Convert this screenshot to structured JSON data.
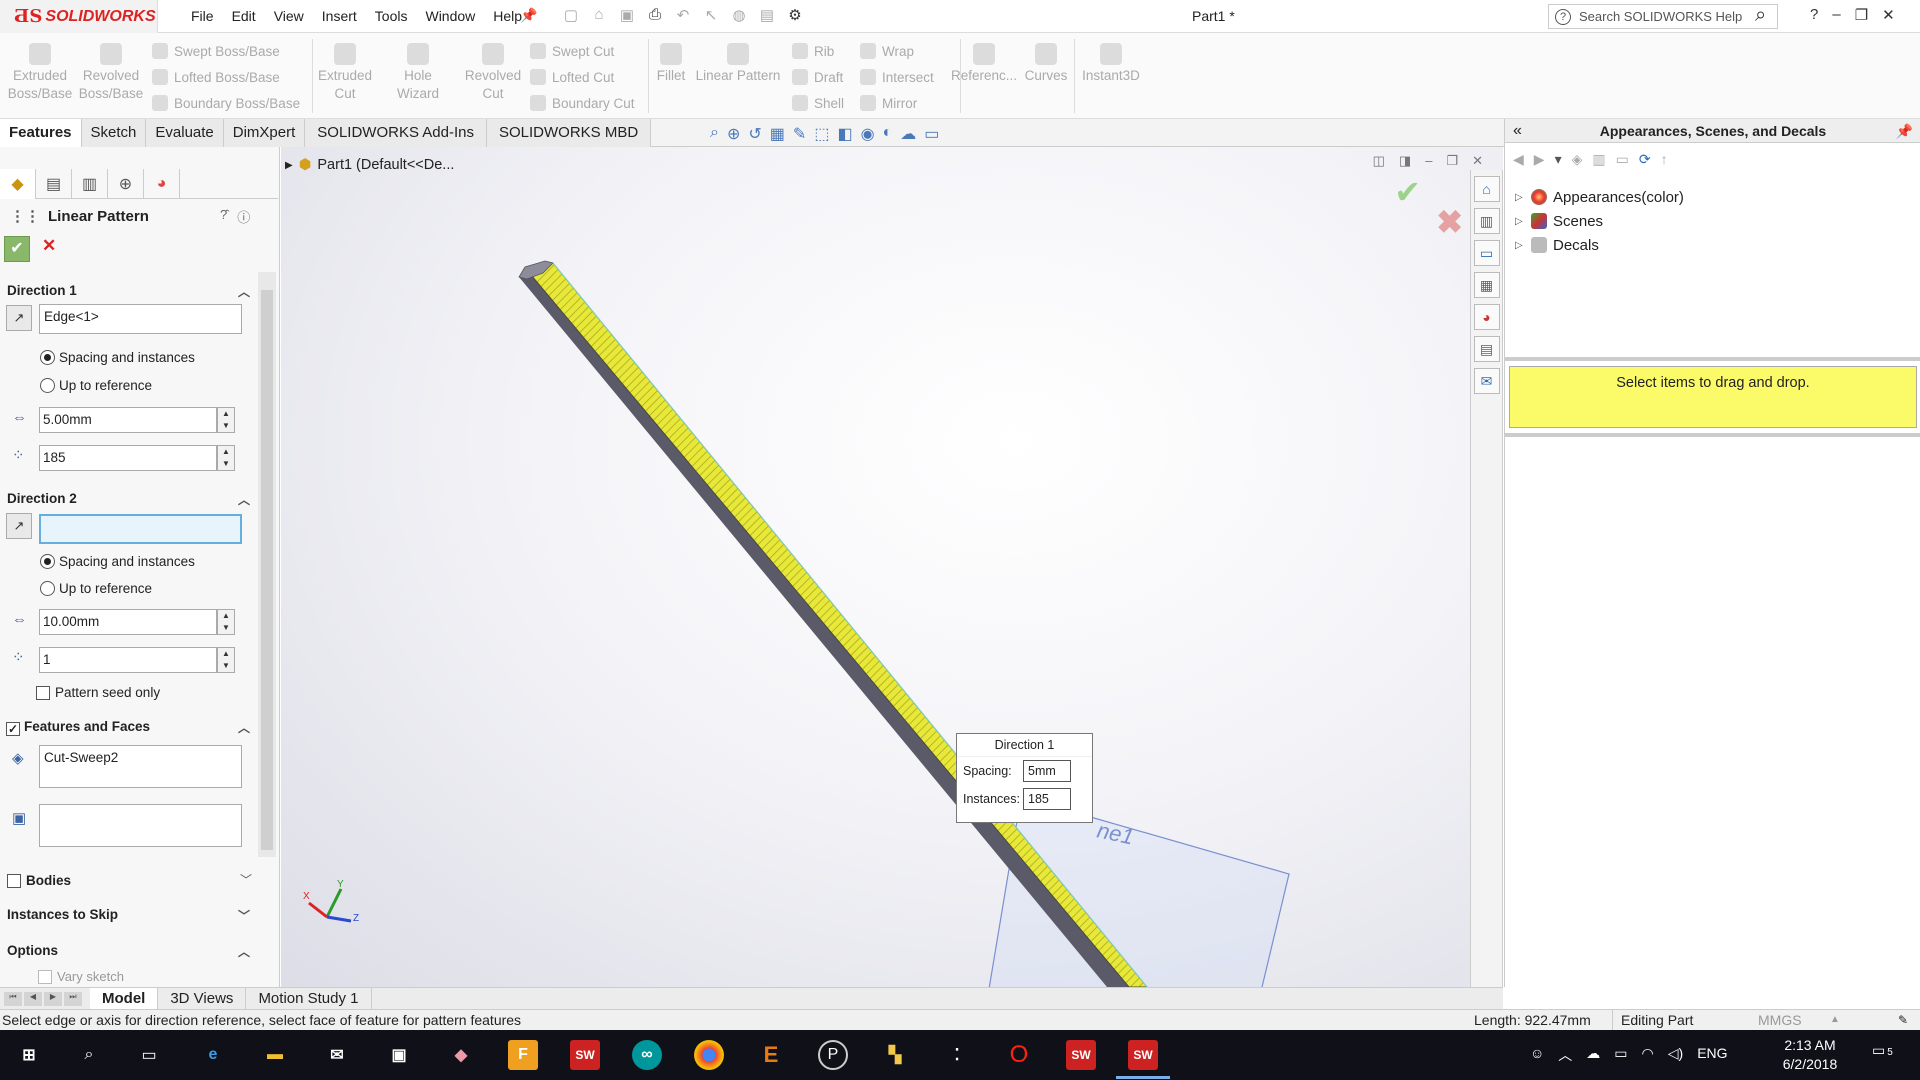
{
  "app": {
    "brand": "SOLIDWORKS",
    "doc_title": "Part1 *",
    "menu": [
      "File",
      "Edit",
      "View",
      "Insert",
      "Tools",
      "Window",
      "Help"
    ],
    "search_placeholder": "Search SOLIDWORKS Help"
  },
  "commands": {
    "extruded_boss": "Extruded Boss/Base",
    "revolved_boss": "Revolved Boss/Base",
    "swept_boss": "Swept Boss/Base",
    "lofted_boss": "Lofted Boss/Base",
    "boundary_boss": "Boundary Boss/Base",
    "extruded_cut": "Extruded Cut",
    "hole_wizard": "Hole Wizard",
    "revolved_cut": "Revolved Cut",
    "swept_cut": "Swept Cut",
    "lofted_cut": "Lofted Cut",
    "boundary_cut": "Boundary Cut",
    "fillet": "Fillet",
    "linear_pattern": "Linear Pattern",
    "rib": "Rib",
    "draft": "Draft",
    "shell": "Shell",
    "wrap": "Wrap",
    "intersect": "Intersect",
    "mirror": "Mirror",
    "reference": "Referenc...",
    "curves": "Curves",
    "instant3d": "Instant3D"
  },
  "tabs": [
    "Features",
    "Sketch",
    "Evaluate",
    "DimXpert",
    "SOLIDWORKS Add-Ins",
    "SOLIDWORKS MBD"
  ],
  "property_manager": {
    "title": "Linear Pattern",
    "direction1": {
      "header": "Direction 1",
      "edge": "Edge<1>",
      "opt_spacing": "Spacing and instances",
      "opt_reference": "Up to reference",
      "spacing": "5.00mm",
      "instances": "185"
    },
    "direction2": {
      "header": "Direction 2",
      "edge": "",
      "opt_spacing": "Spacing and instances",
      "opt_reference": "Up to reference",
      "spacing": "10.00mm",
      "instances": "1",
      "seed_only": "Pattern seed only"
    },
    "features": {
      "header": "Features and Faces",
      "value": "Cut-Sweep2"
    },
    "bodies": "Bodies",
    "instances_skip": "Instances to Skip",
    "options": "Options",
    "vary_sketch": "Vary sketch"
  },
  "viewport": {
    "tree_label": "Part1  (Default<<De...",
    "callout": {
      "title": "Direction 1",
      "spacing_label": "Spacing:",
      "spacing_value": "5mm",
      "instances_label": "Instances:",
      "instances_value": "185"
    },
    "plane_label": "ne1"
  },
  "task_pane": {
    "title": "Appearances, Scenes, and Decals",
    "items": [
      "Appearances(color)",
      "Scenes",
      "Decals"
    ],
    "drop_hint": "Select items to drag and drop."
  },
  "bottom_tabs": [
    "Model",
    "3D Views",
    "Motion Study 1"
  ],
  "status": {
    "message": "Select edge or axis for direction reference, select face of feature for pattern features",
    "length": "Length: 922.47mm",
    "mode": "Editing Part",
    "units": "MMGS"
  },
  "taskbar": {
    "time": "2:13 AM",
    "date": "6/2/2018",
    "lang": "ENG",
    "notifications": "5"
  }
}
